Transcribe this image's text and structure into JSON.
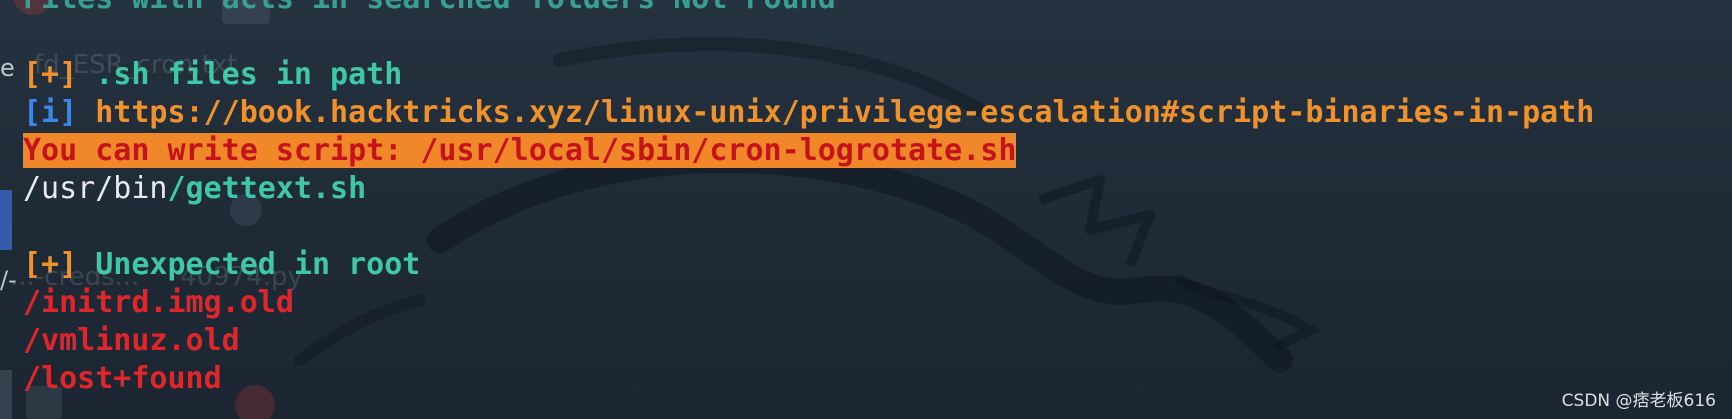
{
  "terminal": {
    "lines": [
      {
        "segments": [
          {
            "text": "Files with acls in searched folders Not Found",
            "style": "green-dim"
          }
        ]
      },
      {
        "segments": [
          {
            "text": " ",
            "style": "white"
          }
        ]
      },
      {
        "segments": [
          {
            "text": "[+]",
            "style": "orange"
          },
          {
            "text": " .sh files in path",
            "style": "green"
          }
        ]
      },
      {
        "segments": [
          {
            "text": "[i]",
            "style": "blue"
          },
          {
            "text": " https://book.hacktricks.xyz/linux-unix/privilege-escalation#script-binaries-in-path",
            "style": "orange"
          }
        ]
      },
      {
        "segments": [
          {
            "text": "You can write script: /usr/local/sbin/cron-logrotate.sh",
            "style": "highlight"
          }
        ]
      },
      {
        "segments": [
          {
            "text": "/usr/bin",
            "style": "white"
          },
          {
            "text": "/gettext.sh",
            "style": "green"
          }
        ]
      },
      {
        "segments": [
          {
            "text": " ",
            "style": "white"
          }
        ]
      },
      {
        "segments": [
          {
            "text": "[+]",
            "style": "orange"
          },
          {
            "text": " Unexpected in root",
            "style": "green"
          }
        ]
      },
      {
        "segments": [
          {
            "text": "/initrd.img.old",
            "style": "red"
          }
        ]
      },
      {
        "segments": [
          {
            "text": "/vmlinuz.old",
            "style": "red"
          }
        ]
      },
      {
        "segments": [
          {
            "text": "/lost+found",
            "style": "red"
          }
        ]
      }
    ]
  },
  "desktop_icons": {
    "label_1": "fd_ESR_cron.txt",
    "label_2": "...-creds...",
    "label_3": "40974.py"
  },
  "left_edge": {
    "char_1": "e",
    "char_2": "/-"
  },
  "watermark": "CSDN @痞老板616",
  "colors": {
    "background": "#1f2b38",
    "green": "#3ec7a9",
    "orange": "#f0922c",
    "blue": "#3b86e8",
    "red": "#e0262a",
    "highlight_bg": "#f0882a",
    "highlight_fg": "#c4131b"
  }
}
